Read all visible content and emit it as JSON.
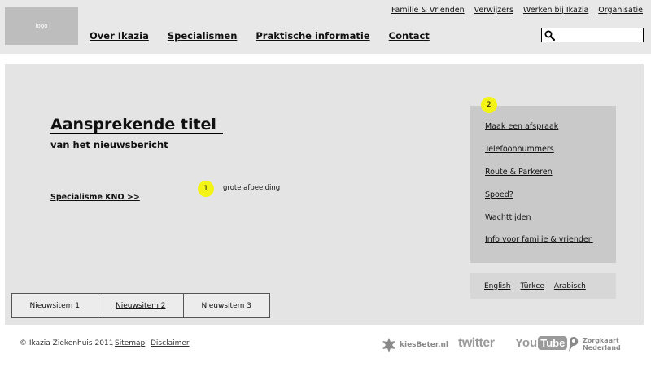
{
  "header": {
    "logo": "logo",
    "top_links": [
      "Familie & Vrienden",
      "Verwijzers",
      "Werken bij Ikazia",
      "Organisatie"
    ],
    "main_nav": [
      "Over Ikazia",
      "Specialismen",
      "Praktische informatie",
      "Contact"
    ],
    "search": {
      "value": "",
      "icon": "search-icon"
    }
  },
  "hero": {
    "title": "Aansprekende titel",
    "subtitle": "van het nieuwsbericht",
    "specialism_link": "Specialisme KNO  >>",
    "marker1": "1",
    "image_label": "grote afbeelding",
    "marker2": "2"
  },
  "quick_links": [
    "Maak een afspraak",
    "Telefoonnummers",
    "Route & Parkeren",
    "Spoed?",
    "Wachttijden",
    "Info voor familie & vrienden"
  ],
  "languages": [
    "English",
    "Türkce",
    "Arabisch"
  ],
  "news_items": [
    "Nieuwsitem 1",
    "Nieuwsitem 2",
    "Nieuwsitem 3"
  ],
  "footer": {
    "copyright": "© Ikazia Ziekenhuis 2011",
    "sitemap": "Sitemap",
    "disclaimer": "Disclaimer",
    "kiesbeter": "kiesBeter.nl",
    "twitter": "twitter",
    "youtube_you": "You",
    "youtube_tube": "Tube",
    "zorgkaart_1": "Zorgkaart",
    "zorgkaart_2": "Nederland"
  },
  "colors": {
    "marker": "#f3f315",
    "header_bg": "#e8e8e8",
    "hero_bg": "#e4e4e4",
    "quickbox_bg": "#c9c9c9"
  }
}
